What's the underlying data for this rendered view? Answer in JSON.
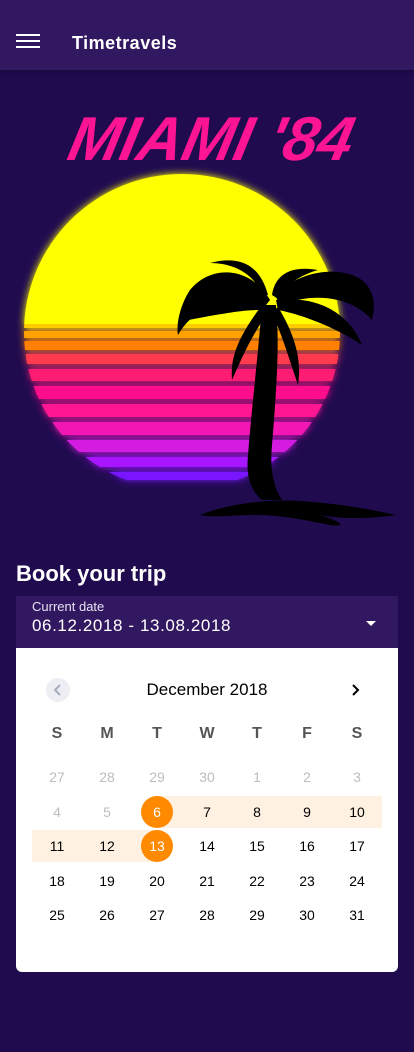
{
  "appbar": {
    "title": "Timetravels",
    "menu_icon": "hamburger-menu-icon"
  },
  "hero": {
    "headline": "MIAMI '84",
    "colors": {
      "text": "#ff1493",
      "sun": "#ffff00",
      "palm": "#000000"
    }
  },
  "booking": {
    "title": "Book your trip",
    "field_label": "Current date",
    "field_value": "06.12.2018 - 13.08.2018"
  },
  "calendar": {
    "month": "December 2018",
    "weekdays": [
      "S",
      "M",
      "T",
      "W",
      "T",
      "F",
      "S"
    ],
    "selected_color": "#ff8a00",
    "range_color": "#fff1e1",
    "weeks": [
      [
        {
          "d": "27",
          "muted": true
        },
        {
          "d": "28",
          "muted": true
        },
        {
          "d": "29",
          "muted": true
        },
        {
          "d": "30",
          "muted": true
        },
        {
          "d": "1",
          "muted": true
        },
        {
          "d": "2",
          "muted": true
        },
        {
          "d": "3",
          "muted": true
        }
      ],
      [
        {
          "d": "4",
          "muted": true
        },
        {
          "d": "5",
          "muted": true
        },
        {
          "d": "6",
          "selected": true
        },
        {
          "d": "7"
        },
        {
          "d": "8"
        },
        {
          "d": "9"
        },
        {
          "d": "10"
        }
      ],
      [
        {
          "d": "11"
        },
        {
          "d": "12"
        },
        {
          "d": "13",
          "selected": true
        },
        {
          "d": "14"
        },
        {
          "d": "15"
        },
        {
          "d": "16"
        },
        {
          "d": "17"
        }
      ],
      [
        {
          "d": "18"
        },
        {
          "d": "19"
        },
        {
          "d": "20"
        },
        {
          "d": "21"
        },
        {
          "d": "22"
        },
        {
          "d": "23"
        },
        {
          "d": "24"
        }
      ],
      [
        {
          "d": "25"
        },
        {
          "d": "26"
        },
        {
          "d": "27"
        },
        {
          "d": "28"
        },
        {
          "d": "29"
        },
        {
          "d": "30"
        },
        {
          "d": "31"
        }
      ]
    ]
  }
}
